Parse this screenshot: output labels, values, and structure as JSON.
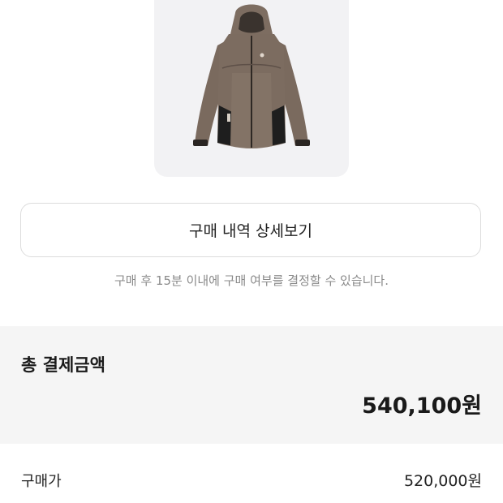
{
  "product": {
    "image_alt": "product-jacket-image"
  },
  "detail_button": {
    "label": "구매 내역 상세보기"
  },
  "notice": {
    "text": "구매 후 15분 이내에 구매 여부를 결정할 수 있습니다."
  },
  "summary": {
    "title": "총 결제금액",
    "amount": "540,100원"
  },
  "rows": [
    {
      "label": "구매가",
      "value": "520,000원"
    }
  ],
  "colors": {
    "card_bg": "#f2f2f4",
    "summary_bg": "#f5f5f5",
    "jacket_main": "#7a6a5e",
    "jacket_dark": "#1e1e1e"
  }
}
